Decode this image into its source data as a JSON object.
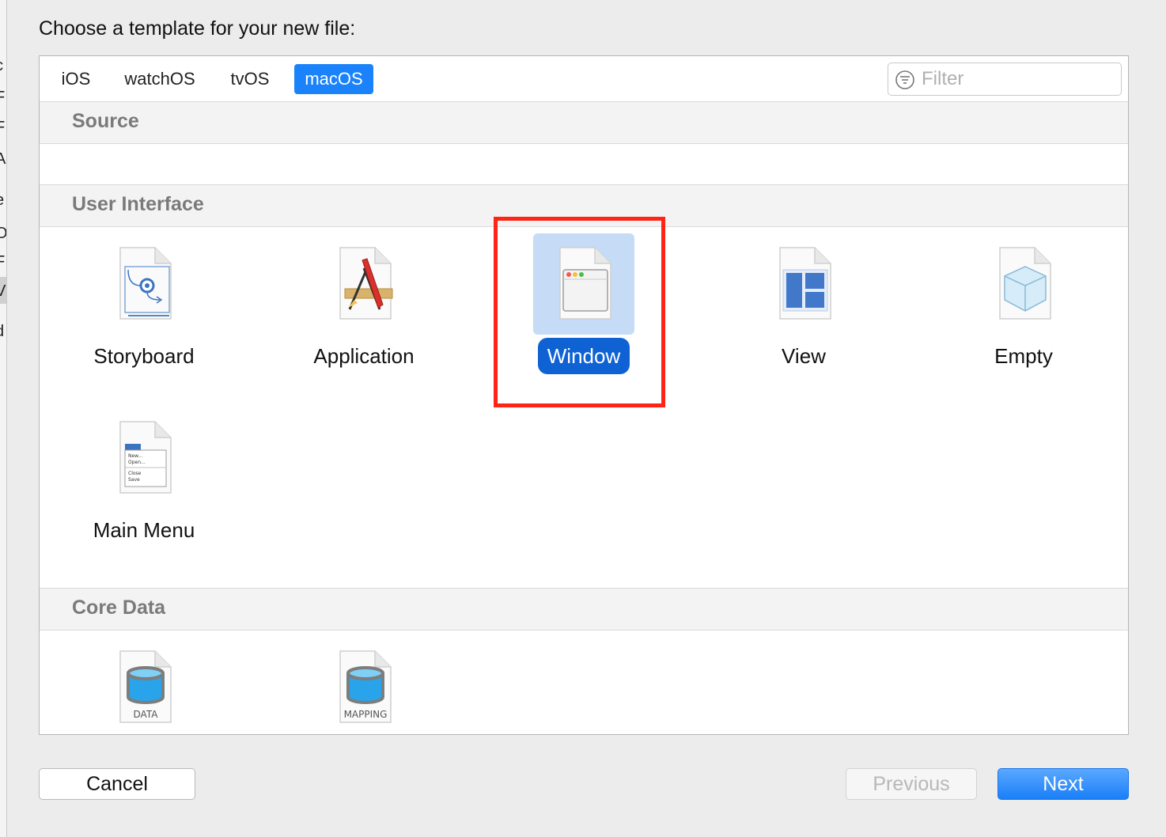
{
  "dialog": {
    "prompt": "Choose a template for your new file:"
  },
  "platform_tabs": [
    {
      "label": "iOS"
    },
    {
      "label": "watchOS"
    },
    {
      "label": "tvOS"
    },
    {
      "label": "macOS",
      "active": true
    }
  ],
  "filter": {
    "placeholder": "Filter",
    "value": ""
  },
  "sections": [
    {
      "title": "Source",
      "templates": []
    },
    {
      "title": "User Interface",
      "templates": [
        {
          "label": "Storyboard",
          "icon": "storyboard-icon"
        },
        {
          "label": "Application",
          "icon": "application-icon"
        },
        {
          "label": "Window",
          "icon": "window-icon",
          "selected": true
        },
        {
          "label": "View",
          "icon": "view-icon"
        },
        {
          "label": "Empty",
          "icon": "empty-icon"
        },
        {
          "label": "Main Menu",
          "icon": "main-menu-icon"
        }
      ]
    },
    {
      "title": "Core Data",
      "templates": [
        {
          "label": "DATA",
          "icon": "data-model-icon"
        },
        {
          "label": "MAPPING",
          "icon": "mapping-model-icon"
        }
      ]
    }
  ],
  "main_menu_icon_text": [
    "New...",
    "Open...",
    "Close",
    "Save"
  ],
  "buttons": {
    "cancel": "Cancel",
    "previous": "Previous",
    "next": "Next"
  },
  "colors": {
    "accent": "#1a82fb",
    "selection_fill": "#c6dbf5",
    "selection_label": "#0e62d3",
    "highlight_box": "#ff2415"
  },
  "background_window": {
    "edge_glyphs": [
      "c",
      "F",
      "F",
      "A",
      "e",
      "O",
      "F",
      "V",
      "d"
    ]
  }
}
